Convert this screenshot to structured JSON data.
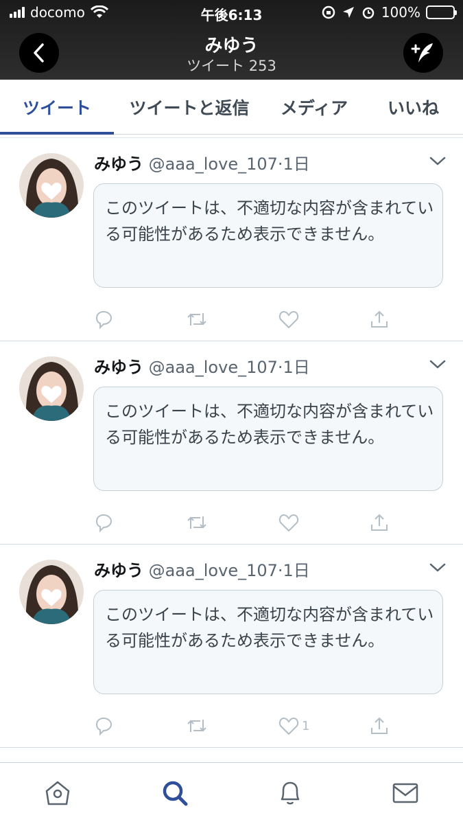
{
  "status_bar": {
    "carrier": "docomo",
    "time": "午後6:13",
    "battery": "100%"
  },
  "header": {
    "title": "みゆう",
    "subtitle": "ツイート 253"
  },
  "tabs": [
    {
      "label": "ツイート",
      "active": true
    },
    {
      "label": "ツイートと返信",
      "active": false
    },
    {
      "label": "メディア",
      "active": false
    },
    {
      "label": "いいね",
      "active": false
    }
  ],
  "tweets": [
    {
      "name": "みゆう",
      "handle": "@aaa_love_107",
      "time": "·1日",
      "notice": "このツイートは、不適切な内容が含まれている可能性があるため表示できません。",
      "like_count": ""
    },
    {
      "name": "みゆう",
      "handle": "@aaa_love_107",
      "time": "·1日",
      "notice": "このツイートは、不適切な内容が含まれている可能性があるため表示できません。",
      "like_count": ""
    },
    {
      "name": "みゆう",
      "handle": "@aaa_love_107",
      "time": "·1日",
      "notice": "このツイートは、不適切な内容が含まれている可能性があるため表示できません。",
      "like_count": "1"
    }
  ],
  "colors": {
    "accent": "#2f4f9a",
    "header_bg": "#1b1b1b",
    "action_icon": "#b3bdc6"
  },
  "icons": {
    "back": "chevron-left-icon",
    "compose": "compose-feather-icon",
    "caret": "chevron-down-icon",
    "reply": "reply-icon",
    "retweet": "retweet-icon",
    "like": "heart-icon",
    "share": "share-icon",
    "home": "home-icon",
    "search": "search-icon",
    "notifications": "bell-icon",
    "messages": "envelope-icon"
  }
}
